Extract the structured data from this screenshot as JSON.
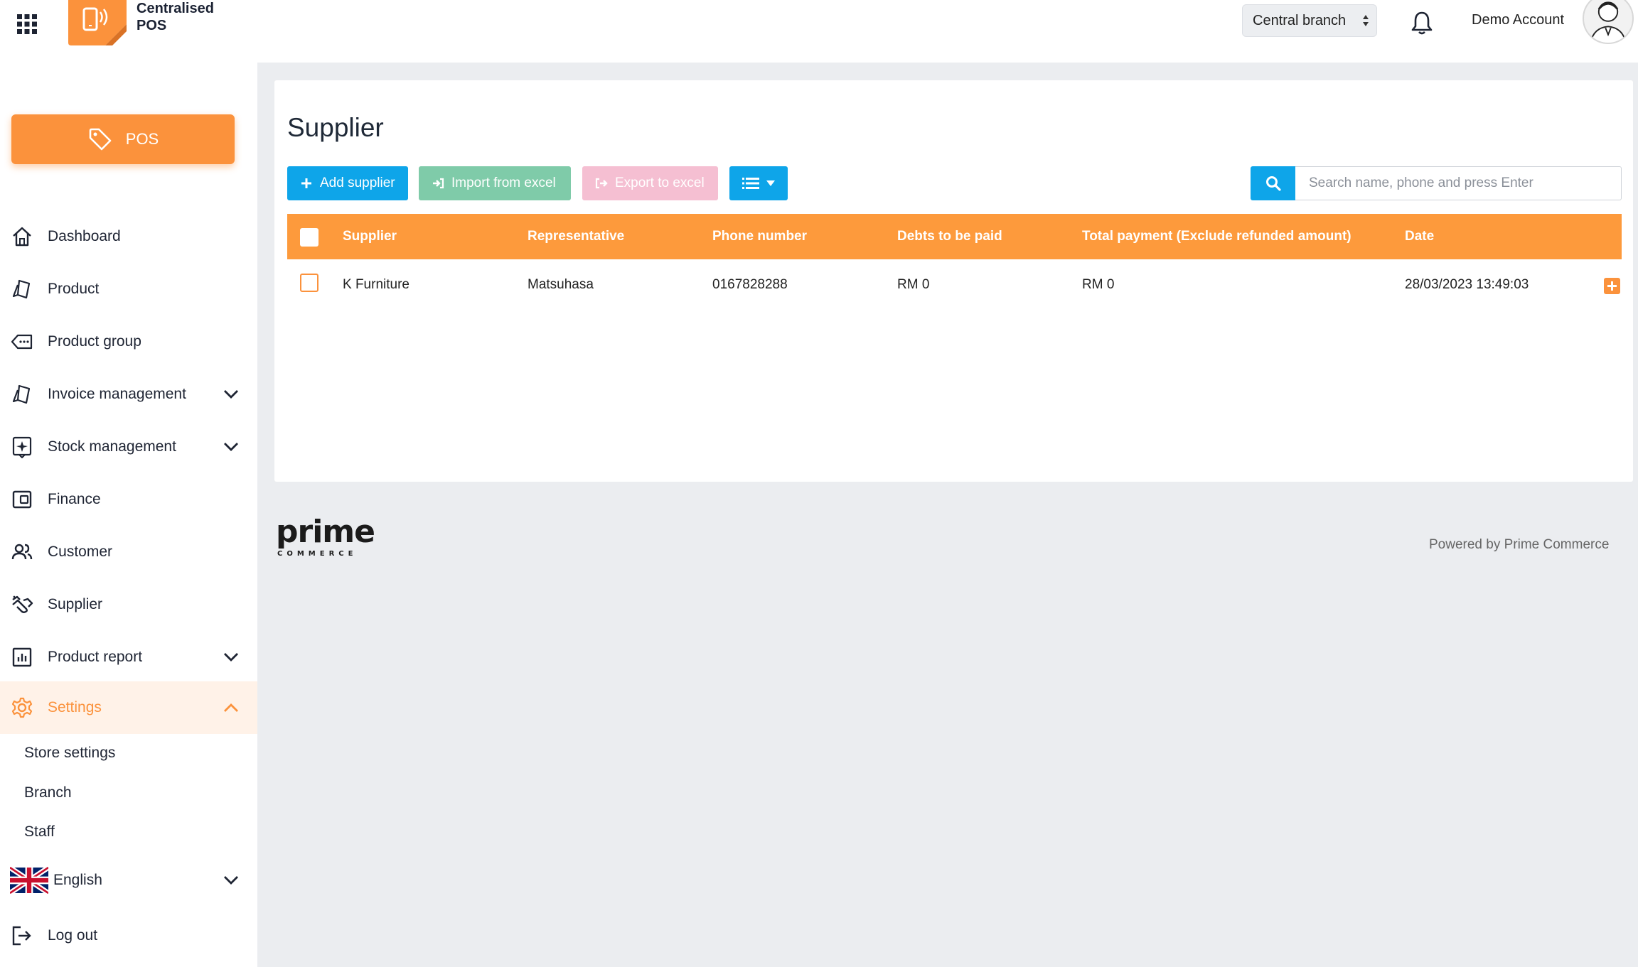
{
  "brand": {
    "title_line1": "Centralised",
    "title_line2": "POS"
  },
  "header": {
    "branch": "Central branch",
    "account": "Demo Account"
  },
  "sidebar": {
    "pos_label": "POS",
    "items": [
      {
        "label": "Dashboard"
      },
      {
        "label": "Product"
      },
      {
        "label": "Product group"
      },
      {
        "label": "Invoice management"
      },
      {
        "label": "Stock management"
      },
      {
        "label": "Finance"
      },
      {
        "label": "Customer"
      },
      {
        "label": "Supplier"
      },
      {
        "label": "Product report"
      },
      {
        "label": "Settings"
      }
    ],
    "settings_sub": [
      "Store settings",
      "Branch",
      "Staff"
    ],
    "language": "English",
    "logout": "Log out"
  },
  "page": {
    "title": "Supplier",
    "buttons": {
      "add": "Add supplier",
      "import": "Import from excel",
      "export": "Export to excel"
    },
    "search_placeholder": "Search name, phone and press Enter",
    "columns": [
      "Supplier",
      "Representative",
      "Phone number",
      "Debts to be paid",
      "Total payment (Exclude refunded amount)",
      "Date"
    ],
    "rows": [
      {
        "supplier": "K Furniture",
        "representative": "Matsuhasa",
        "phone": "0167828288",
        "debts": "RM 0",
        "total": "RM 0",
        "date": "28/03/2023 13:49:03"
      }
    ]
  },
  "footer": {
    "logo_word": "prime",
    "logo_sub": "COMMERCE",
    "powered": "Powered by Prime Commerce"
  },
  "colors": {
    "accent": "#fb923c",
    "primary": "#0ea5e9",
    "import": "#7fcba9",
    "export": "#f5bfd2",
    "table_header": "#fd9a3c"
  }
}
